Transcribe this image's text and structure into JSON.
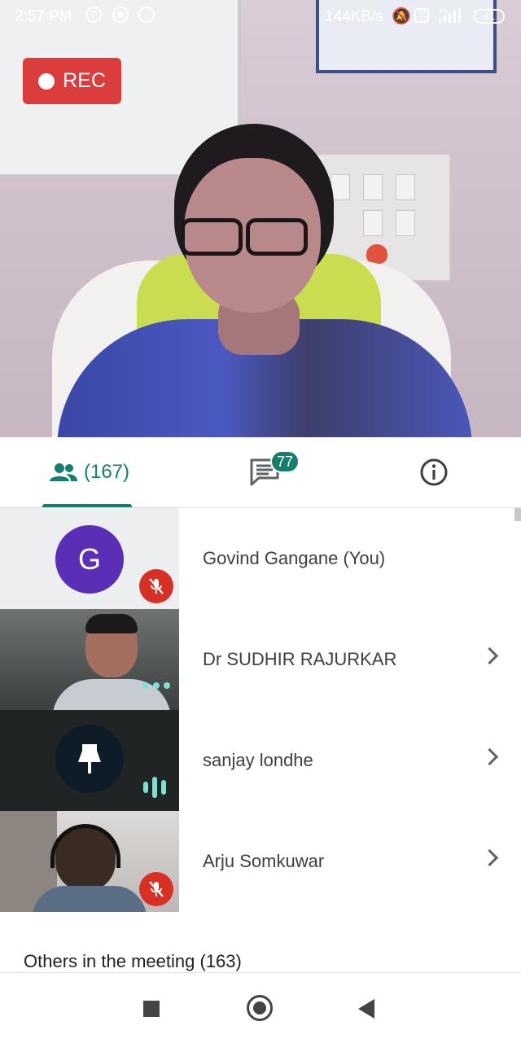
{
  "status_bar": {
    "time": "2:57 PM",
    "speed": "144KB/s",
    "battery": "41",
    "network": "4G",
    "icons": [
      "whatsapp-icon",
      "meet-icon",
      "chat-icon",
      "mute-bell-icon",
      "volte-icon",
      "signal-icon",
      "battery-icon"
    ]
  },
  "video": {
    "rec_label": "REC"
  },
  "tabs": {
    "people_count": "(167)",
    "chat_badge": "77"
  },
  "participants": [
    {
      "name": "Govind Gangane (You)",
      "avatar_letter": "G",
      "muted": true
    },
    {
      "name": "Dr SUDHIR RAJURKAR",
      "muted": false
    },
    {
      "name": "sanjay londhe",
      "pinned": true,
      "speaking": true
    },
    {
      "name": "Arju Somkuwar",
      "muted": true
    }
  ],
  "others_label": "Others in the meeting (163)",
  "colors": {
    "accent": "#137f6c",
    "rec": "#db3d3d",
    "mic_off": "#d93025",
    "avatar_g": "#5a2fb5"
  }
}
